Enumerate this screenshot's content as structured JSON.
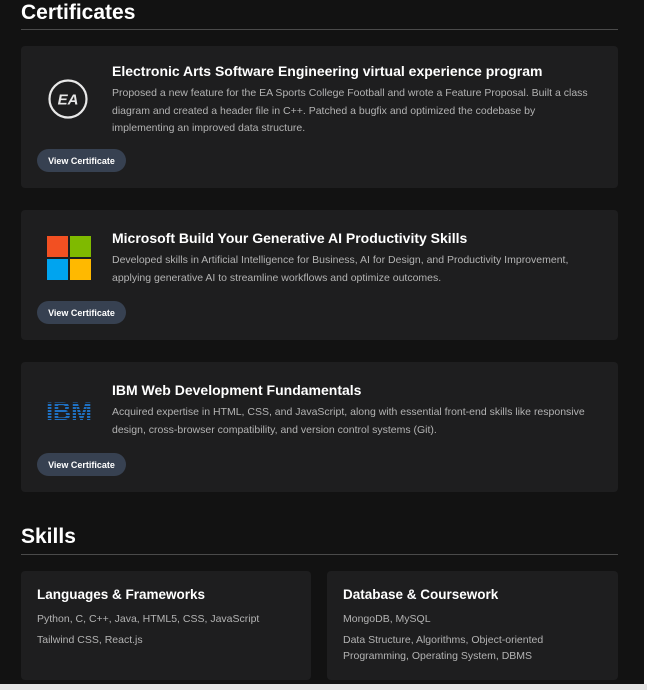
{
  "certificates": {
    "heading": "Certificates",
    "items": [
      {
        "title": "Electronic Arts Software Engineering virtual experience program",
        "description": "Proposed a new feature for the EA Sports College Football and wrote a Feature Proposal. Built a class diagram and created a header file in C++. Patched a bugfix and optimized the codebase by implementing an improved data structure.",
        "button_label": "View Certificate",
        "logo_text": "EA",
        "logo": "ea-logo"
      },
      {
        "title": "Microsoft Build Your Generative AI Productivity Skills",
        "description": "Developed skills in Artificial Intelligence for Business, AI for Design, and Productivity Improvement, applying generative AI to streamline workflows and optimize outcomes.",
        "button_label": "View Certificate",
        "logo": "microsoft-logo",
        "logo_colors": [
          "#f25022",
          "#7fba00",
          "#00a4ef",
          "#ffb900"
        ]
      },
      {
        "title": "IBM Web Development Fundamentals",
        "description": "Acquired expertise in HTML, CSS, and JavaScript, along with essential front-end skills like responsive design, cross-browser compatibility, and version control systems (Git).",
        "button_label": "View Certificate",
        "logo_text": "IBM",
        "logo": "ibm-logo",
        "logo_color": "#1f70c1"
      }
    ]
  },
  "skills": {
    "heading": "Skills",
    "cards": [
      {
        "title": "Languages & Frameworks",
        "lines": [
          "Python, C, C++, Java, HTML5, CSS, JavaScript",
          "Tailwind CSS, React.js"
        ]
      },
      {
        "title": "Database & Coursework",
        "lines": [
          "MongoDB, MySQL",
          "Data Structure, Algorithms, Object-oriented",
          "Programming, Operating System, DBMS"
        ]
      }
    ]
  },
  "colors": {
    "background": "#121212",
    "card": "#1e1e1f",
    "button": "#374151",
    "text_muted": "#b3b3b3"
  }
}
